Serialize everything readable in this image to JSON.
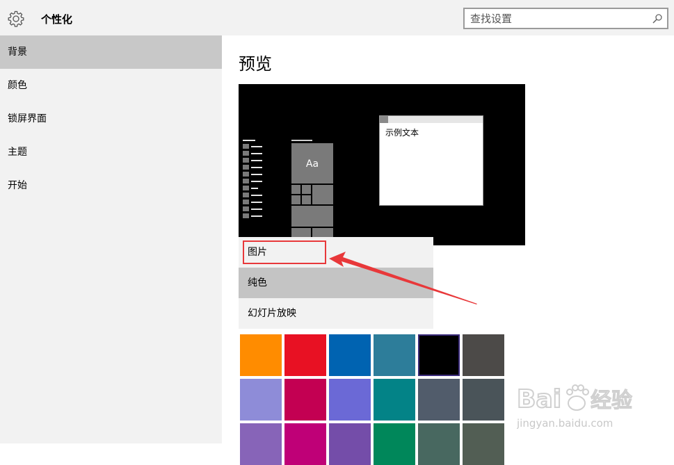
{
  "header": {
    "icon": "gear-icon",
    "title": "个性化",
    "search": {
      "placeholder": "查找设置",
      "value": "",
      "icon": "search-icon"
    }
  },
  "sidebar": {
    "items": [
      {
        "label": "背景",
        "selected": true
      },
      {
        "label": "颜色",
        "selected": false
      },
      {
        "label": "锁屏界面",
        "selected": false
      },
      {
        "label": "主题",
        "selected": false
      },
      {
        "label": "开始",
        "selected": false
      }
    ]
  },
  "main": {
    "heading": "预览",
    "preview": {
      "tile_label": "Aa",
      "sample_text": "示例文本"
    },
    "background_dropdown": {
      "options": [
        "图片",
        "纯色",
        "幻灯片放映"
      ],
      "highlighted": "纯色",
      "annotated": "图片"
    },
    "swatches": [
      "#ff8c00",
      "#e81123",
      "#0063b1",
      "#2d7d9a",
      "#000000",
      "#4c4a48",
      "#8e8cd8",
      "#c30052",
      "#6b69d6",
      "#038387",
      "#515c6b",
      "#4a5459",
      "#8764b8",
      "#bf0077",
      "#744da9",
      "#00875a",
      "#486860",
      "#525e54"
    ],
    "selected_swatch_color": "#000000"
  },
  "watermark": {
    "text": "Baidu经验",
    "url_text": "jingyan.baidu.com"
  },
  "colors": {
    "annotation": "#e8383a",
    "panel": "#f2f2f2",
    "selected": "#c8c8c8"
  }
}
